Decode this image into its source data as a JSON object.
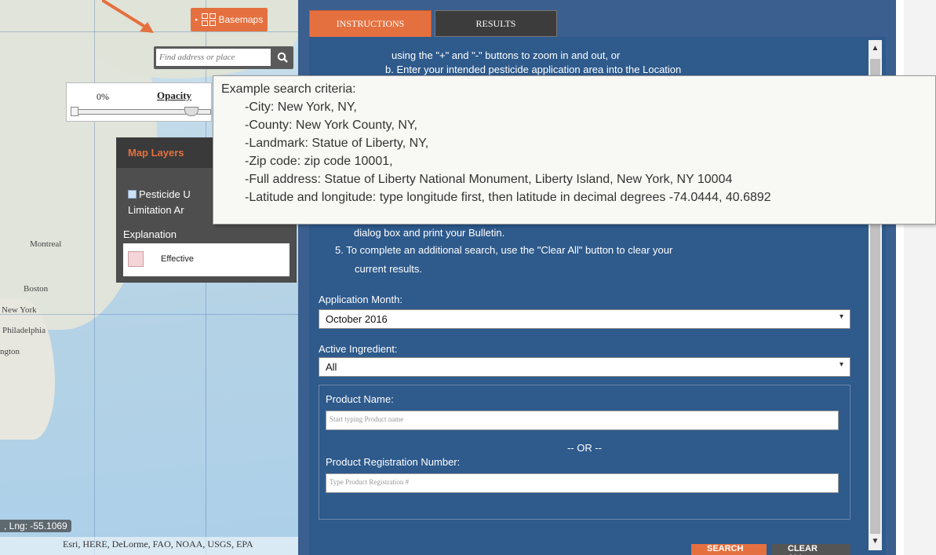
{
  "map": {
    "search": {
      "placeholder": "Find address or place"
    },
    "basemaps_label": "Basemaps",
    "opacity": {
      "percent": "0%",
      "label": "Opacity",
      "value": 0.9
    },
    "layers": {
      "title": "Map Layers",
      "layer_name_line1": "Pesticide U",
      "layer_name_line2": "Limitation Ar",
      "explanation": "Explanation",
      "legend_label": "Effective",
      "legend_color": "#f4d4d6"
    },
    "places": [
      "Montreal",
      "Boston",
      "New York",
      "Philadelphia",
      "ngton"
    ],
    "coords": ", Lng: -55.1069",
    "attribution": "Esri, HERE, DeLorme, FAO, NOAA, USGS, EPA"
  },
  "tabs": {
    "instructions": "INSTRUCTIONS",
    "results": "RESULTS"
  },
  "instructions": {
    "line1": "using the \"+\" and \"-\" buttons to zoom in and out, or",
    "line2": "b. Enter your intended pesticide application area into the Location",
    "line3": "dialog box and print your Bulletin.",
    "line4": "5. To complete an additional search, use the \"Clear All\" button to clear your",
    "line5": "current results."
  },
  "form": {
    "month_label": "Application Month:",
    "month_value": "October 2016",
    "ingredient_label": "Active Ingredient:",
    "ingredient_value": "All",
    "product_name_label": "Product Name:",
    "product_name_placeholder": "Start typing Product name",
    "or_text": "-- OR --",
    "reg_number_label": "Product Registration Number:",
    "reg_number_placeholder": "Type Product Registration #",
    "search_button": "SEARCH",
    "clear_button": "CLEAR ALL"
  },
  "tooltip": {
    "title": "Example search criteria:",
    "items": [
      "-City: New York, NY,",
      "-County: New York County, NY,",
      "-Landmark: Statue of Liberty, NY,",
      "-Zip code: zip code 10001,",
      "-Full address: Statue of Liberty National Monument, Liberty Island, New York, NY 10004",
      "-Latitude and longitude: type longitude first, then latitude in decimal degrees -74.0444, 40.6892"
    ]
  },
  "colors": {
    "accent": "#e5703f",
    "panel": "#2e5a8c"
  }
}
